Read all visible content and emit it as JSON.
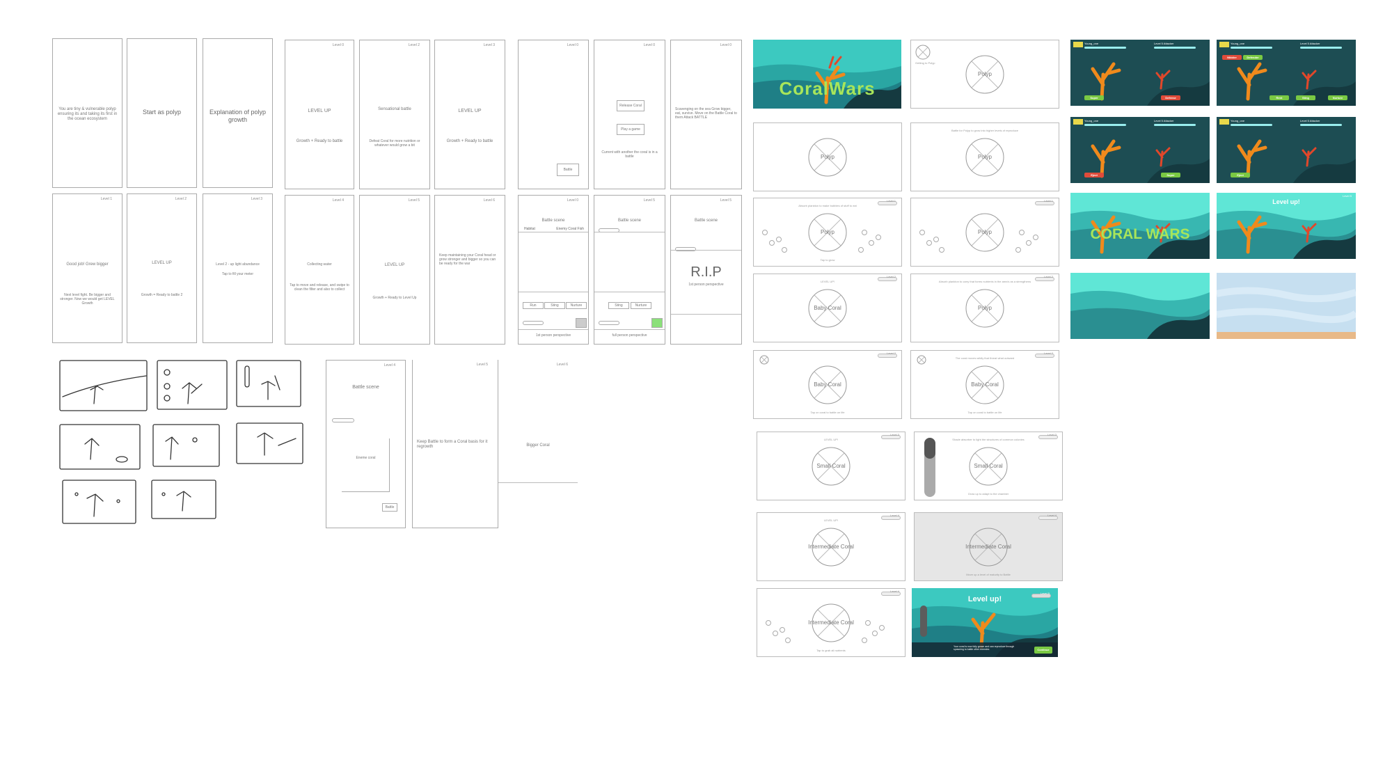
{
  "colors": {
    "teal_dark": "#1d4d53",
    "teal": "#38b7b1",
    "aqua": "#5fe6d6",
    "coral_orange": "#f08a1c",
    "coral_red": "#e2472a",
    "title_green": "#a8e55a",
    "sand": "#e8b988",
    "sky_blue": "#c6dff0",
    "btn_green": "#7ac943",
    "btn_red": "#e04b3a"
  },
  "storyboard": {
    "row1": {
      "f1": "You are tiny & vulnerable polyp ensuring its and taking its first in the ocean ecosystem",
      "f2": "Start as polyp",
      "f3": "Explanation of polyp growth",
      "f4_level": "Level 0",
      "f4_a": "LEVEL UP",
      "f4_b": "Growth + Ready to battle",
      "f5_level": "Level 2",
      "f5_a": "Sensational battle",
      "f5_b": "Defeat Coral for more nutrition or whatever would grow a bit",
      "f6_level": "Level 3",
      "f6_a": "LEVEL UP",
      "f6_b": "Growth + Ready to battle",
      "f7_level": "Level 0",
      "f7_btn": "Battle",
      "f8_level": "Level 0",
      "f8_btn1": "Release Coral",
      "f8_btn2": "Play a game",
      "f8_text": "Current with another the coral is in a battle",
      "f9_level": "Level 0",
      "f9_text": "Scavenging on the sea Grow bigger, eat, survive. Move on the Battle Coral to them Attack BATTLE"
    },
    "row2": {
      "f1_level": "Level 1",
      "f1_a": "Good job! Grew bigger",
      "f1_b": "Next level fight. Be bigger and stronger. Now we would get LEVEL Growth",
      "f2_level": "Level 2",
      "f2_a": "LEVEL UP",
      "f2_b": "Growth = Ready to battle 2",
      "f3_level": "Level 3",
      "f3_a": "Level 2 - up light abundance",
      "f3_b": "Tap to fill your meter",
      "f4_level": "Level 4",
      "f4_a": "Collecting water",
      "f4_b": "Tap to move and release, and swipe to clean the filter and also to collect",
      "f5_level": "Level 5",
      "f5_a": "LEVEL UP",
      "f5_b": "Growth + Ready to Level Up",
      "f6_level": "Level 6",
      "f6_a": "Keep maintaining your Coral head or grow stronger and bigger so you can be ready for the war",
      "f7_level": "Level 0",
      "f7_title": "Battle scene",
      "f7_left": "Habitat",
      "f7_right": "Enemy Coral Fish",
      "f7_tabs": [
        "Run",
        "Sting",
        "Nurture"
      ],
      "f7_foot": "1st person perspective",
      "f8_level": "Level 5",
      "f8_title": "Battle scene",
      "f8_tabs": [
        "Sting",
        "Nurture"
      ],
      "f8_foot": "full person perspective",
      "f9_level": "Level 5",
      "f9_title": "Battle scene",
      "f9_big": "R.I.P",
      "f9_sub": "1st person perspective"
    },
    "row3": {
      "f1_level": "Level 4",
      "f1_title": "Battle scene",
      "f1_inner": "Eneme coral",
      "f1_btn": "Battle",
      "f2_level": "Level 5",
      "f2_text": "Keep Battle to form a Coral basis for it regrowth",
      "f3_level": "Level 6",
      "f3_text": "Bigger Coral"
    }
  },
  "wireframes": {
    "title_screen": "CoralWars",
    "w2": {
      "label": "Polyp",
      "corner": "Getting to Polyp"
    },
    "w3": {
      "label": "Polyp"
    },
    "w4": {
      "label": "Polyp",
      "top": "Battle for Polyp to grow into higher levels of reproduce"
    },
    "w5": {
      "label": "Polyp",
      "level": "Level 1",
      "top": "Absorb plankton to make bubbles of stuff to eat",
      "note": "Tap to grow"
    },
    "w6": {
      "label": "Polyp",
      "level": "Level 1"
    },
    "w7": {
      "label": "Baby Coral",
      "level": "Level 2",
      "top": "LEVEL UP!"
    },
    "w8": {
      "label": "Polyp",
      "level": "Level 2",
      "top": "Absorb plankton to carry that forms nutrients in the area's as a strengthens"
    },
    "w9": {
      "label": "Baby Coral",
      "level": "Level 2",
      "note": "Tap on coral to battle on life"
    },
    "w10": {
      "label": "Baby Coral",
      "level": "Level 2",
      "top": "The coral moves wildly that threat what outward",
      "note": "Tap on coral to battle on life"
    },
    "w11": {
      "label": "Small Coral",
      "level": "Level 3",
      "top": "LEVEL UP!"
    },
    "w12": {
      "label": "Small Coral",
      "level": "Level 3",
      "top": "Shade absorber to light the structures of common colonies",
      "note": "Grow up to adapt to the chamber"
    },
    "w13": {
      "label": "Intermediate Coral",
      "level": "Level 4",
      "top": "LEVEL UP!"
    },
    "w14": {
      "label": "Intermediate Coral",
      "level": "Level 4",
      "note": "Move up a level of maturity to Battle"
    },
    "w15": {
      "label": "Intermediate Coral",
      "level": "Level 4",
      "note": "Tap to grab all nutrients"
    },
    "w16": {
      "title": "Level up!",
      "level": "Level 5",
      "body": "Your coral is now fully grown and can reproduce through spawning to battle other enemies",
      "btn": "Continue"
    }
  },
  "game_screens": {
    "hud_player": "Young_one",
    "hud_enemy": "Level 5 Attacker",
    "buttons_a": [
      "Super",
      "Defense"
    ],
    "buttons_b": [
      "Nibbler",
      "Defender",
      "Rent",
      "Sting",
      "Nurture"
    ],
    "buttons_c": [
      "Eject",
      "Super"
    ],
    "buttons_d": [
      "Eject"
    ],
    "title2": "CORAL WARS",
    "levelup": "Level up!",
    "levelup_level": "Level 5"
  }
}
